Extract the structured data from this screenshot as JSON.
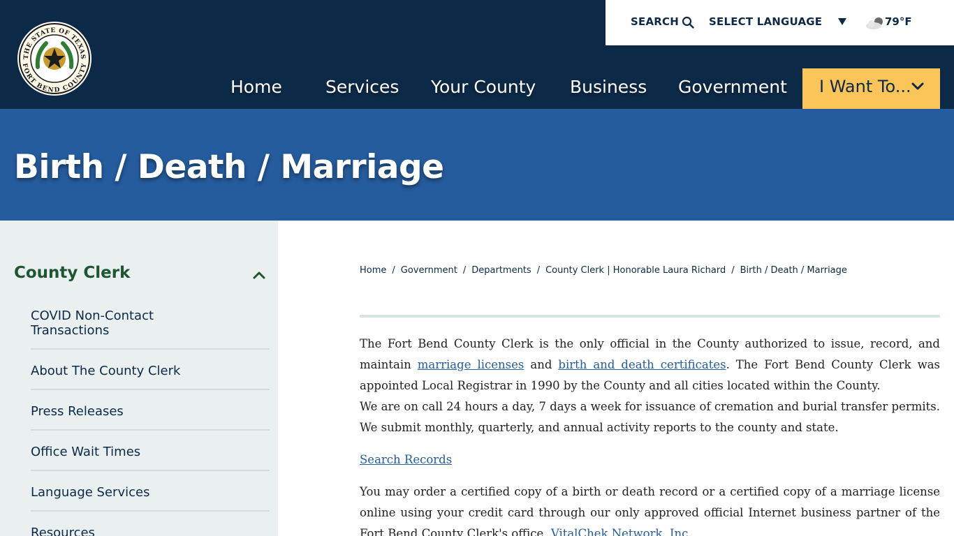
{
  "utility": {
    "search_label": "SEARCH",
    "language_label": "SELECT LANGUAGE",
    "temperature": "79°F",
    "search_icon": "search-icon",
    "weather_icon": "cloudy-icon"
  },
  "seal": {
    "top_text": "THE STATE OF TEXAS",
    "bottom_text": "FORT BEND COUNTY"
  },
  "nav": {
    "home": "Home",
    "services": "Services",
    "your_county": "Your County",
    "business": "Business",
    "government": "Government",
    "i_want_to": "I Want To..."
  },
  "banner": {
    "title": "Birth / Death / Marriage"
  },
  "sidebar": {
    "heading": "County Clerk",
    "items": [
      {
        "label": "COVID Non-Contact Transactions"
      },
      {
        "label": "About The County Clerk"
      },
      {
        "label": "Press Releases"
      },
      {
        "label": "Office Wait Times"
      },
      {
        "label": "Language Services"
      },
      {
        "label": "Resources"
      }
    ]
  },
  "breadcrumb": [
    "Home",
    "Government",
    "Departments",
    "County Clerk | Honorable Laura Richard",
    "Birth / Death / Marriage"
  ],
  "content": {
    "p1_a": "The Fort Bend County Clerk is the only official in the County authorized to issue, record, and maintain ",
    "link_marriage": "marriage licenses",
    "p1_b": " and ",
    "link_birth_death": "birth and death certificates",
    "p1_c": ". The Fort Bend County Clerk was appointed Local Registrar in 1990 by the County and all cities located within the County.",
    "p2": "We are on call 24 hours a day, 7 days a week for issuance of cremation and burial transfer permits. We submit monthly, quarterly, and annual activity reports to the county and state.",
    "link_search": "Search Records",
    "p3_a": "You may order a certified copy of a birth or death record or a certified copy of a marriage license online using your credit card through our only approved official Internet business partner of the Fort Bend County Clerk's office, ",
    "link_vitalchek": "VitalChek Network, Inc."
  },
  "colors": {
    "header_bg": "#0c2a47",
    "banner_bg": "#255c9e",
    "accent_yellow": "#fbc55a",
    "sidebar_bg": "#eaeff0",
    "sidebar_heading": "#1e5631",
    "link": "#255c9e"
  }
}
